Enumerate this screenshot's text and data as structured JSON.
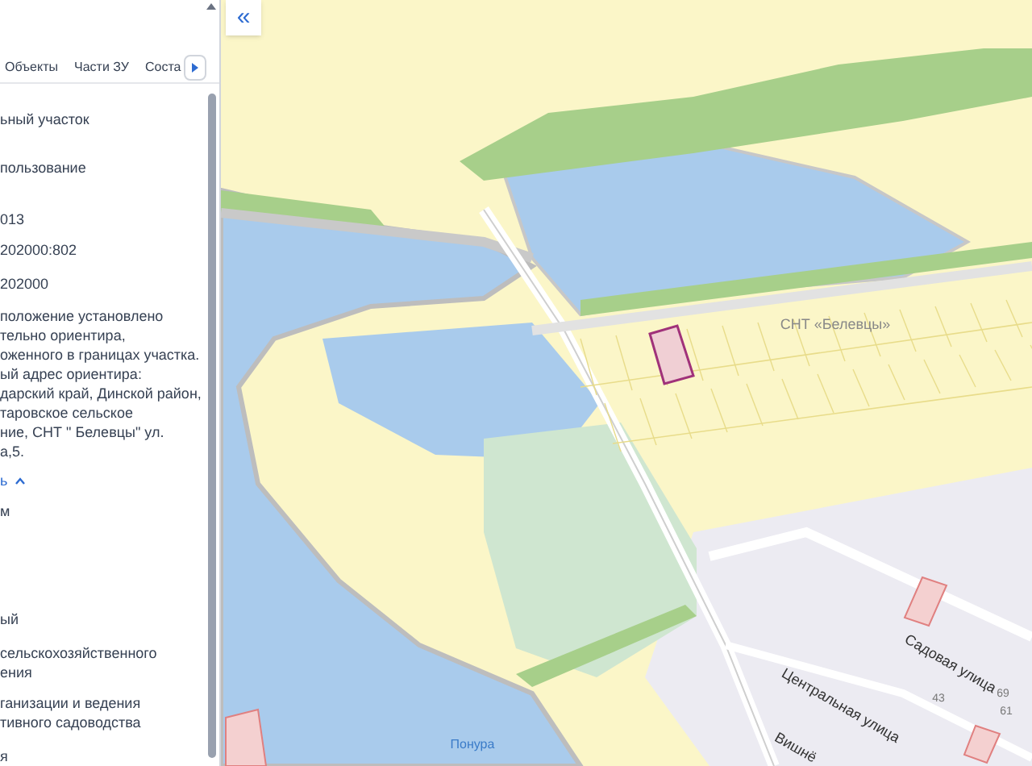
{
  "panel": {
    "tabs": [
      {
        "label": "Объекты",
        "selected": false
      },
      {
        "label": "Части ЗУ",
        "selected": false
      },
      {
        "label": "Соста",
        "selected": false
      }
    ],
    "fields": [
      {
        "kind": "text",
        "text": "ьный участок"
      },
      {
        "kind": "text",
        "text": "пользование"
      },
      {
        "kind": "text",
        "text": "013"
      },
      {
        "kind": "text",
        "text": "202000:802"
      },
      {
        "kind": "text",
        "text": "202000"
      },
      {
        "kind": "paragraph",
        "lines": [
          "положение установлено",
          "тельно ориентира,",
          "оженного в границах участка.",
          "ый адрес ориентира:",
          "дарский край, Динской район,",
          "таровское сельское",
          "ние, СНТ \" Белевцы\" ул.",
          "а,5."
        ]
      },
      {
        "kind": "link",
        "text": "ь"
      },
      {
        "kind": "text",
        "text": "м"
      },
      {
        "kind": "text",
        "text": "ый"
      },
      {
        "kind": "paragraph",
        "lines": [
          "сельскохозяйственного",
          "ения"
        ]
      },
      {
        "kind": "paragraph",
        "lines": [
          "ганизации и ведения",
          "тивного садоводства"
        ]
      },
      {
        "kind": "text",
        "text": "я"
      }
    ]
  },
  "map": {
    "collapse_label": "«",
    "labels": [
      {
        "kind": "area",
        "text": "СНТ «Белевцы»"
      },
      {
        "kind": "street",
        "text": "Садовая улица"
      },
      {
        "kind": "street",
        "text": "Центральная улица"
      },
      {
        "kind": "street",
        "text": "Вишнё"
      },
      {
        "kind": "river",
        "text": "Понура"
      },
      {
        "kind": "number",
        "text": "43"
      },
      {
        "kind": "number",
        "text": "69"
      },
      {
        "kind": "number",
        "text": "61"
      }
    ]
  }
}
